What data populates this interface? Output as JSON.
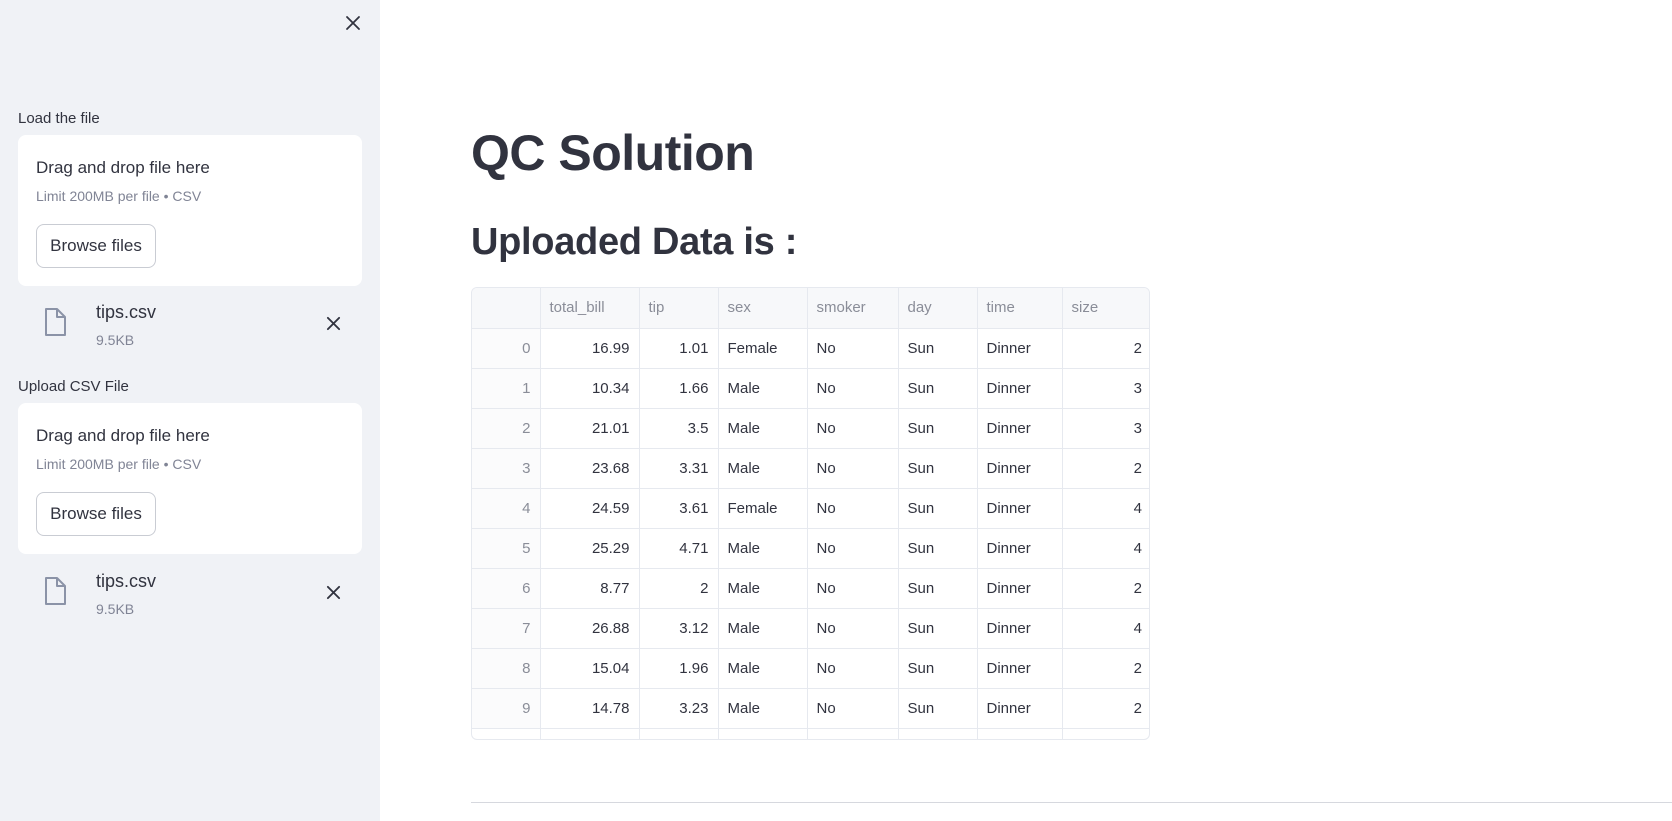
{
  "sidebar": {
    "uploaders": [
      {
        "label": "Load the file",
        "dropzone_title": "Drag and drop file here",
        "dropzone_limit": "Limit 200MB per file • CSV",
        "browse_label": "Browse files",
        "file_name": "tips.csv",
        "file_size": "9.5KB"
      },
      {
        "label": "Upload CSV File",
        "dropzone_title": "Drag and drop file here",
        "dropzone_limit": "Limit 200MB per file • CSV",
        "browse_label": "Browse files",
        "file_name": "tips.csv",
        "file_size": "9.5KB"
      }
    ]
  },
  "main": {
    "title": "QC Solution",
    "subtitle": "Uploaded Data is :"
  },
  "table": {
    "columns": [
      "",
      "total_bill",
      "tip",
      "sex",
      "smoker",
      "day",
      "time",
      "size"
    ],
    "rows": [
      [
        "0",
        "16.99",
        "1.01",
        "Female",
        "No",
        "Sun",
        "Dinner",
        "2"
      ],
      [
        "1",
        "10.34",
        "1.66",
        "Male",
        "No",
        "Sun",
        "Dinner",
        "3"
      ],
      [
        "2",
        "21.01",
        "3.5",
        "Male",
        "No",
        "Sun",
        "Dinner",
        "3"
      ],
      [
        "3",
        "23.68",
        "3.31",
        "Male",
        "No",
        "Sun",
        "Dinner",
        "2"
      ],
      [
        "4",
        "24.59",
        "3.61",
        "Female",
        "No",
        "Sun",
        "Dinner",
        "4"
      ],
      [
        "5",
        "25.29",
        "4.71",
        "Male",
        "No",
        "Sun",
        "Dinner",
        "4"
      ],
      [
        "6",
        "8.77",
        "2",
        "Male",
        "No",
        "Sun",
        "Dinner",
        "2"
      ],
      [
        "7",
        "26.88",
        "3.12",
        "Male",
        "No",
        "Sun",
        "Dinner",
        "4"
      ],
      [
        "8",
        "15.04",
        "1.96",
        "Male",
        "No",
        "Sun",
        "Dinner",
        "2"
      ],
      [
        "9",
        "14.78",
        "3.23",
        "Male",
        "No",
        "Sun",
        "Dinner",
        "2"
      ]
    ]
  },
  "icons": {
    "close": "close-icon",
    "file": "file-icon",
    "remove": "remove-file-icon"
  }
}
